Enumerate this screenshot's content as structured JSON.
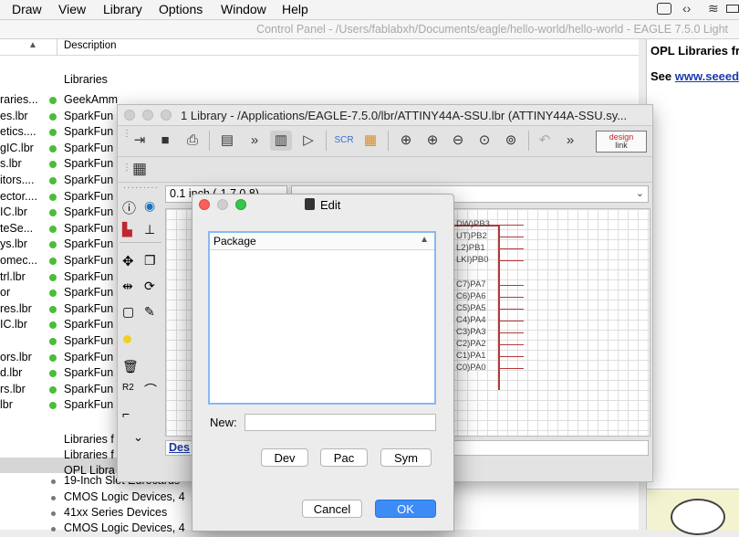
{
  "menubar": {
    "items": [
      "Draw",
      "View",
      "Library",
      "Options",
      "Window",
      "Help"
    ]
  },
  "control_panel": {
    "title": "Control Panel - /Users/fablabxh/Documents/eagle/hello-world/hello-world - EAGLE 7.5.0 Light",
    "column_header": "Description",
    "libraries_heading": "Libraries",
    "left_items": [
      "raries...",
      "es.lbr",
      "etics....",
      "gIC.lbr",
      "s.lbr",
      "itors....",
      "ector....",
      "IC.lbr",
      "teSe...",
      "ys.lbr",
      "omec...",
      "trl.lbr",
      "or",
      "res.lbr",
      "IC.lbr",
      "",
      "ors.lbr",
      "d.lbr",
      "rs.lbr",
      "lbr"
    ],
    "descriptions": [
      "GeekAmm",
      "SparkFun",
      "SparkFun",
      "SparkFun",
      "SparkFun",
      "SparkFun",
      "SparkFun",
      "SparkFun",
      "SparkFun",
      "SparkFun",
      "SparkFun",
      "SparkFun",
      "SparkFun",
      "SparkFun",
      "SparkFun",
      "SparkFun",
      "SparkFun",
      "SparkFun",
      "SparkFun",
      "SparkFun"
    ],
    "extra_rows": [
      "Libraries f",
      "Libraries f",
      "OPL Libra"
    ],
    "bullet_rows": [
      "19-Inch Slot Eurocards",
      "CMOS Logic Devices, 4",
      "41xx Series Devices",
      "CMOS Logic Devices, 4"
    ]
  },
  "right_panel": {
    "heading": "OPL Libraries fr",
    "see_label": "See ",
    "link": "www.seeed"
  },
  "library_window": {
    "title": "1 Library - /Applications/EAGLE-7.5.0/lbr/ATTINY44A-SSU.lbr (ATTINY44A-SSU.sy...",
    "coordinate": "0.1 inch (-1.7 0.8)",
    "design_link_line1": "design",
    "design_link_line2": "link",
    "status_link": "Des",
    "pins": [
      "DW)PB3",
      "UT)PB2",
      "L2)PB1",
      "LKI)PB0",
      "C7)PA7",
      "C6)PA6",
      "C5)PA5",
      "C4)PA4",
      "C3)PA3",
      "C2)PA2",
      "C1)PA1",
      "C0)PA0"
    ]
  },
  "edit_dialog": {
    "title": "Edit",
    "list_header": "Package",
    "new_label": "New:",
    "new_value": "",
    "dev_button": "Dev",
    "pac_button": "Pac",
    "sym_button": "Sym",
    "cancel_button": "Cancel",
    "ok_button": "OK"
  },
  "colors": {
    "accent_blue": "#3d8bf4",
    "green_dot": "#4cbc3a",
    "pin_red": "#b23a3a",
    "link_blue": "#1a3aa8"
  }
}
